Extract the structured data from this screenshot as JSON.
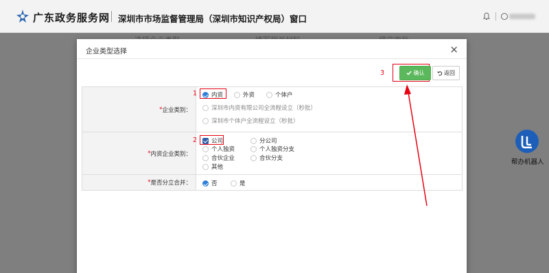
{
  "header": {
    "site_name": "广东政务服务网",
    "dept_name": "深圳市市场监督管理局（深圳市知识产权局）窗口"
  },
  "background": {
    "tab1": "选择企业类型",
    "tab2": "填写相关材料",
    "tab3": "提交审批"
  },
  "robot": {
    "label": "帮办机器人"
  },
  "modal": {
    "title": "企业类型选择",
    "close": "×",
    "confirm_label": "确认",
    "back_label": "返回",
    "annotations": {
      "n1": "1",
      "n2": "2",
      "n3": "3"
    },
    "rows": {
      "enterprise_type": {
        "label": "企业类别：",
        "options": [
          "内资",
          "外资",
          "个体户",
          "深圳市内资有限公司全流程设立（秒批）",
          "深圳市个体户全流程设立（秒批）"
        ],
        "selected": "内资"
      },
      "domestic_type": {
        "label": "内资企业类别：",
        "options": [
          "公司",
          "分公司",
          "个人独资",
          "个人独资分支",
          "合伙企业",
          "合伙分支",
          "其他"
        ],
        "selected": "公司"
      },
      "split_merge": {
        "label": "是否分立合并：",
        "options": [
          "否",
          "是"
        ],
        "selected": "否"
      }
    }
  },
  "colors": {
    "accent_red": "#e60012",
    "confirm_green": "#5cb85c",
    "radio_blue": "#2f7fd8"
  }
}
